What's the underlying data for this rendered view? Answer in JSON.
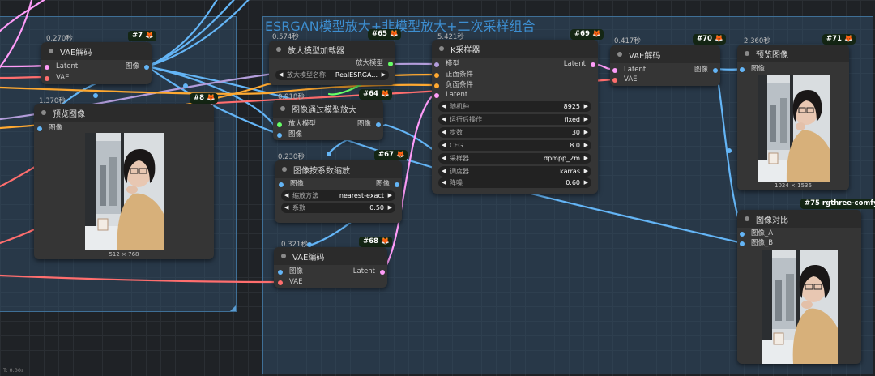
{
  "groups": {
    "g1": {
      "title": ""
    },
    "g2": {
      "title": "ESRGAN模型放大+非模型放大+二次采样组合"
    }
  },
  "nodes": {
    "vae_decode_7": {
      "time": "0.270秒",
      "badge": "#7",
      "title": "VAE解码",
      "in": [
        "Latent",
        "VAE"
      ],
      "out": [
        "图像"
      ]
    },
    "preview_8": {
      "time": "1.370秒",
      "badge": "#8",
      "title": "预览图像",
      "in": [
        "图像"
      ],
      "caption": "512 × 768"
    },
    "upscale_loader_65": {
      "time": "0.574秒",
      "badge": "#65",
      "title": "放大模型加载器",
      "out": [
        "放大模型"
      ],
      "widget": {
        "label": "放大模型名称",
        "value": "RealESRGA..."
      }
    },
    "upscale_model_64": {
      "time": "0.918秒",
      "badge": "#64",
      "title": "图像通过模型放大",
      "in": [
        "放大模型",
        "图像"
      ],
      "out": [
        "图像"
      ]
    },
    "scale_by_67": {
      "time": "0.230秒",
      "badge": "#67",
      "title": "图像按系数缩放",
      "in": [
        "图像"
      ],
      "out": [
        "图像"
      ],
      "widgets": [
        {
          "label": "缩放方法",
          "value": "nearest-exact"
        },
        {
          "label": "系数",
          "value": "0.50"
        }
      ]
    },
    "vae_encode_68": {
      "time": "0.321秒",
      "badge": "#68",
      "title": "VAE编码",
      "in": [
        "图像",
        "VAE"
      ],
      "out": [
        "Latent"
      ]
    },
    "ksampler_69": {
      "time": "5.421秒",
      "badge": "#69",
      "title": "K采样器",
      "in": [
        "模型",
        "正面条件",
        "负面条件",
        "Latent"
      ],
      "out": [
        "Latent"
      ],
      "widgets": [
        {
          "label": "随机种",
          "value": "8925"
        },
        {
          "label": "运行后操作",
          "value": "fixed"
        },
        {
          "label": "步数",
          "value": "30"
        },
        {
          "label": "CFG",
          "value": "8.0"
        },
        {
          "label": "采样器",
          "value": "dpmpp_2m"
        },
        {
          "label": "调度器",
          "value": "karras"
        },
        {
          "label": "降噪",
          "value": "0.60"
        }
      ]
    },
    "vae_decode_70": {
      "time": "0.417秒",
      "badge": "#70",
      "title": "VAE解码",
      "in": [
        "Latent",
        "VAE"
      ],
      "out": [
        "图像"
      ]
    },
    "preview_71": {
      "time": "2.360秒",
      "badge": "#71",
      "title": "预览图像",
      "in": [
        "图像"
      ],
      "caption": "1024 × 1536"
    },
    "compare_75": {
      "badge": "#75 rgthree-comfy",
      "title": "图像对比",
      "in": [
        "图像_A",
        "图像_B"
      ]
    }
  },
  "colors": {
    "image": "#64b5f6",
    "latent": "#ff9cf9",
    "vae": "#ff6e6e",
    "model": "#b39ddb",
    "cond": "#ffa931",
    "upscale_model": "#66ff66"
  },
  "status": {
    "text": "T: 0.00s"
  }
}
